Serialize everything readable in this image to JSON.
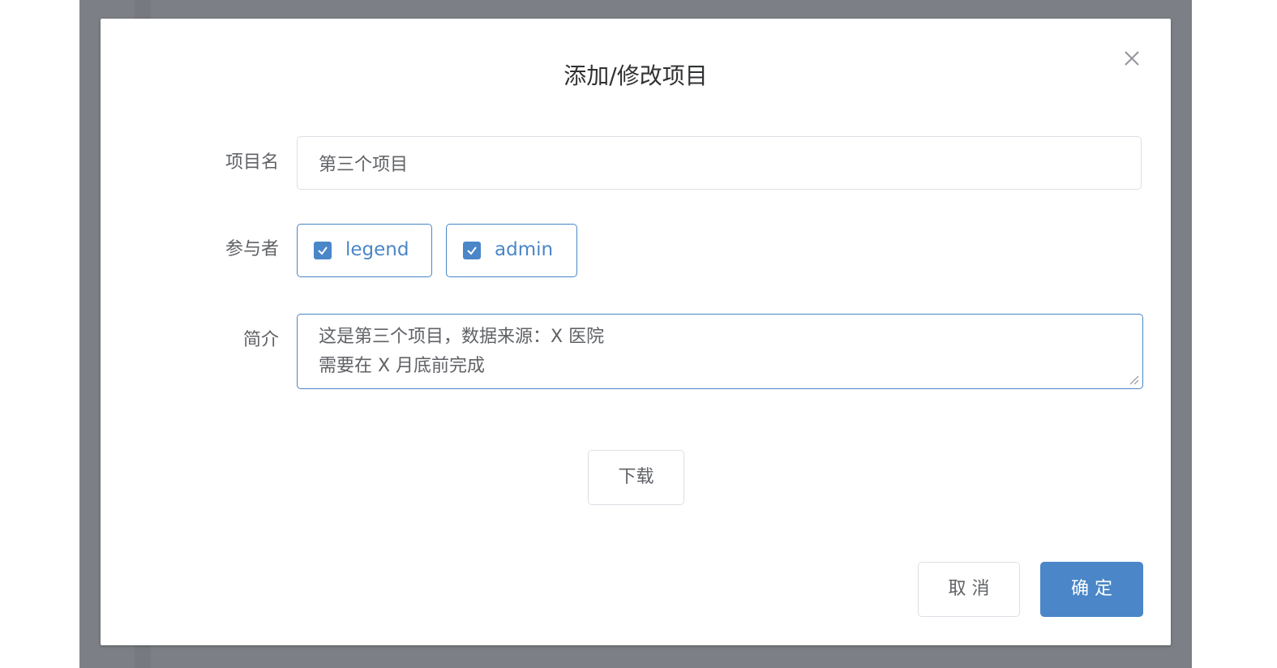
{
  "dialog": {
    "title": "添加/修改项目",
    "close_icon": "close-icon"
  },
  "form": {
    "project_name": {
      "label": "项目名",
      "value": "第三个项目"
    },
    "participants": {
      "label": "参与者",
      "options": [
        {
          "label": "legend",
          "checked": true
        },
        {
          "label": "admin",
          "checked": true
        }
      ]
    },
    "description": {
      "label": "简介",
      "value": "这是第三个项目，数据来源：X 医院\n需要在 X 月底前完成"
    }
  },
  "buttons": {
    "download": "下载",
    "cancel": "取 消",
    "confirm": "确 定"
  },
  "colors": {
    "primary": "#4a86c8",
    "overlay": "#7c7f85",
    "text": "#606266",
    "title": "#303133"
  }
}
